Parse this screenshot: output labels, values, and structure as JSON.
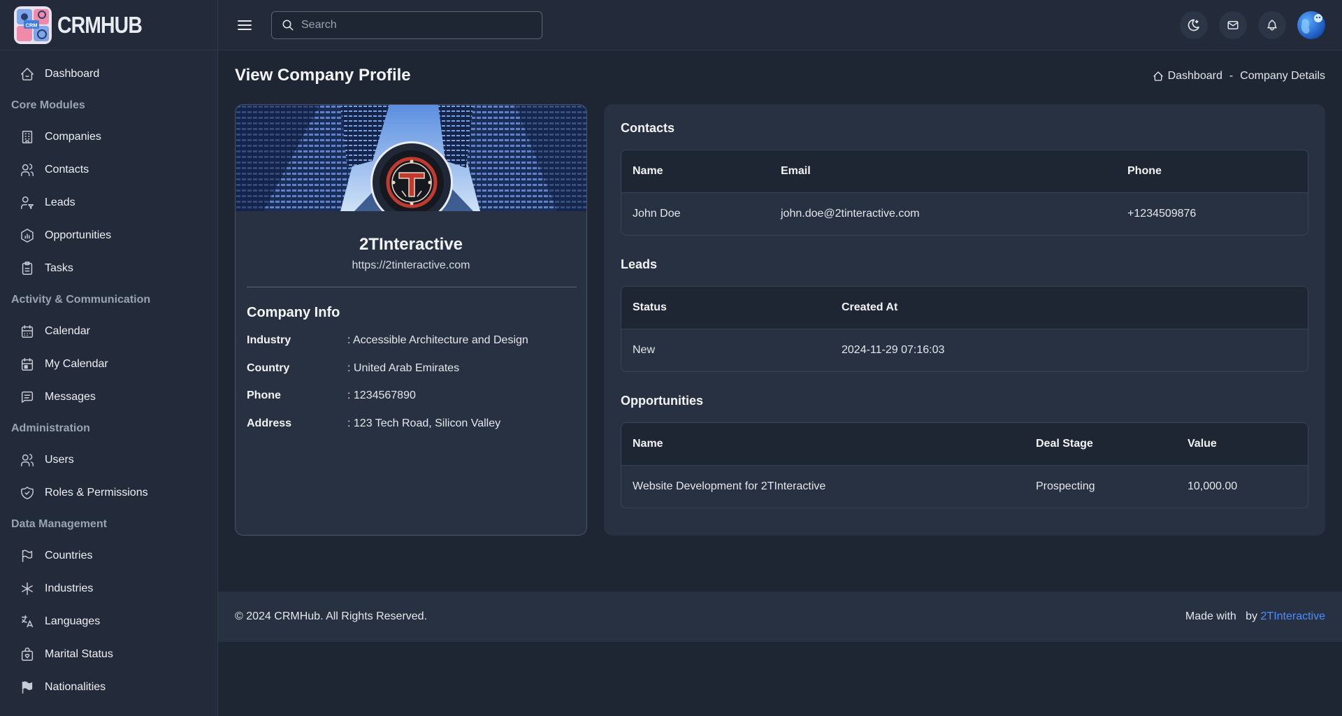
{
  "brand": {
    "name": "CRMHUB",
    "logo_badge": "CRM"
  },
  "sidebar": {
    "items": [
      {
        "label": "Dashboard",
        "icon": "home-icon",
        "type": "item"
      },
      {
        "label": "Core Modules",
        "type": "section"
      },
      {
        "label": "Companies",
        "icon": "building-icon",
        "type": "item"
      },
      {
        "label": "Contacts",
        "icon": "users-icon",
        "type": "item"
      },
      {
        "label": "Leads",
        "icon": "user-filter-icon",
        "type": "item"
      },
      {
        "label": "Opportunities",
        "icon": "chart-hexagon-icon",
        "type": "item"
      },
      {
        "label": "Tasks",
        "icon": "clipboard-icon",
        "type": "item"
      },
      {
        "label": "Activity & Communication",
        "type": "section"
      },
      {
        "label": "Calendar",
        "icon": "calendar-icon",
        "type": "item"
      },
      {
        "label": "My Calendar",
        "icon": "calendar-user-icon",
        "type": "item"
      },
      {
        "label": "Messages",
        "icon": "message-icon",
        "type": "item"
      },
      {
        "label": "Administration",
        "type": "section"
      },
      {
        "label": "Users",
        "icon": "users-icon",
        "type": "item"
      },
      {
        "label": "Roles & Permissions",
        "icon": "shield-check-icon",
        "type": "item"
      },
      {
        "label": "Data Management",
        "type": "section"
      },
      {
        "label": "Countries",
        "icon": "flag-icon",
        "type": "item"
      },
      {
        "label": "Industries",
        "icon": "asterisk-icon",
        "type": "item"
      },
      {
        "label": "Languages",
        "icon": "language-icon",
        "type": "item"
      },
      {
        "label": "Marital Status",
        "icon": "heart-bag-icon",
        "type": "item"
      },
      {
        "label": "Nationalities",
        "icon": "flag-filled-icon",
        "type": "item"
      }
    ]
  },
  "topbar": {
    "search_placeholder": "Search",
    "icons": [
      "menu-icon",
      "moon-icon",
      "mail-icon",
      "bell-icon",
      "avatar"
    ]
  },
  "page": {
    "title": "View Company Profile",
    "breadcrumb": {
      "home": "Dashboard",
      "separator": "-",
      "current": "Company Details"
    }
  },
  "company": {
    "name": "2TInteractive",
    "url": "https://2tinteractive.com",
    "info_title": "Company Info",
    "info": [
      {
        "label": "Industry",
        "value": ": Accessible Architecture and Design"
      },
      {
        "label": "Country",
        "value": ": United Arab Emirates"
      },
      {
        "label": "Phone",
        "value": ": 1234567890"
      },
      {
        "label": "Address",
        "value": ": 123 Tech Road, Silicon Valley"
      }
    ]
  },
  "contacts": {
    "title": "Contacts",
    "columns": [
      "Name",
      "Email",
      "Phone"
    ],
    "rows": [
      [
        "John Doe",
        "john.doe@2tinteractive.com",
        "+1234509876"
      ]
    ]
  },
  "leads": {
    "title": "Leads",
    "columns": [
      "Status",
      "Created At"
    ],
    "rows": [
      [
        "New",
        "2024-11-29 07:16:03"
      ]
    ]
  },
  "opportunities": {
    "title": "Opportunities",
    "columns": [
      "Name",
      "Deal Stage",
      "Value"
    ],
    "rows": [
      [
        "Website Development for 2TInteractive",
        "Prospecting",
        "10,000.00"
      ]
    ]
  },
  "footer": {
    "copyright": "© 2024 CRMHub. All Rights Reserved.",
    "made_with": "Made with",
    "by": "by",
    "author": "2TInteractive",
    "author_color": "#4c8dff"
  }
}
